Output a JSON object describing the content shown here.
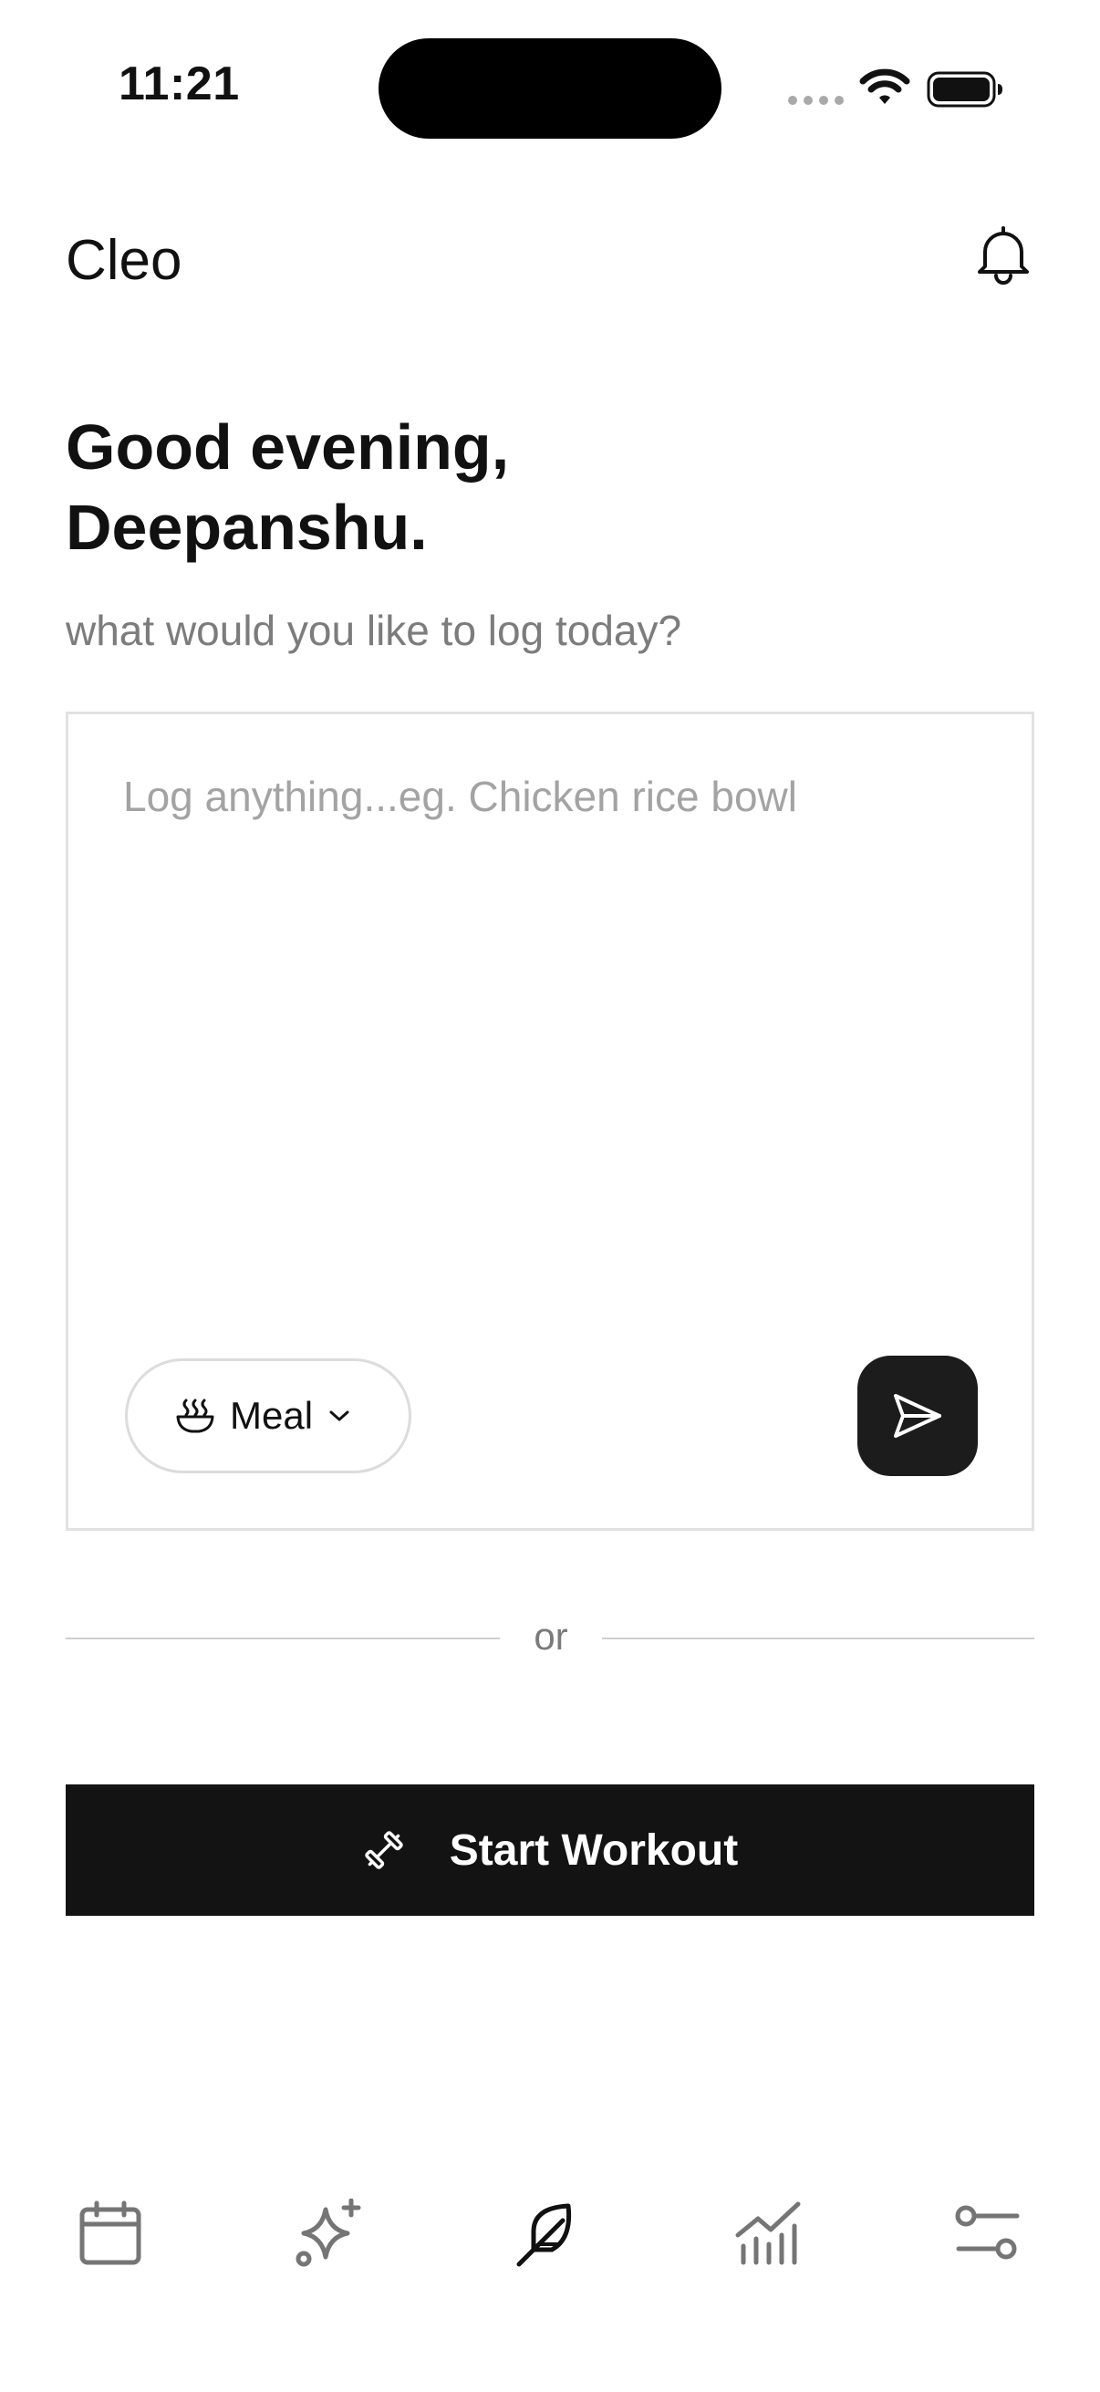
{
  "status_bar": {
    "time": "11:21"
  },
  "header": {
    "app_title": "Cleo",
    "notification_icon": "bell-icon"
  },
  "greeting": {
    "line1": "Good evening,",
    "line2": "Deepanshu.",
    "prompt": "what would you like to log today?"
  },
  "log_box": {
    "placeholder": "Log anything...eg. Chicken rice bowl",
    "value": "",
    "type_selector": {
      "icon": "bowl-icon",
      "selected": "Meal"
    },
    "send_icon": "send-icon"
  },
  "divider": {
    "text": "or"
  },
  "workout_button": {
    "icon": "dumbbell-icon",
    "label": "Start Workout"
  },
  "tab_bar": {
    "tabs": [
      {
        "icon": "calendar-icon",
        "active": false
      },
      {
        "icon": "sparkles-icon",
        "active": false
      },
      {
        "icon": "feather-icon",
        "active": true
      },
      {
        "icon": "chart-icon",
        "active": false
      },
      {
        "icon": "sliders-icon",
        "active": false
      }
    ]
  },
  "colors": {
    "primary": "#131313",
    "muted_text": "#7c7c7c",
    "placeholder": "#a3a3a3",
    "inactive_icon": "#757575",
    "border": "#e2e2e2"
  }
}
